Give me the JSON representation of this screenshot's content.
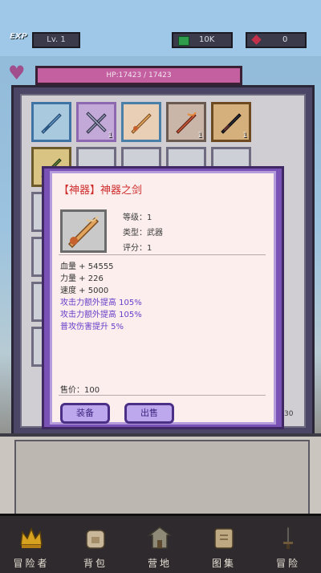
{
  "top": {
    "exp_label": "EXP",
    "level": "Lv. 1",
    "money": "10K",
    "gems": "0"
  },
  "hp": {
    "text": "HP:17423 / 17423"
  },
  "inventory": {
    "slots": [
      {
        "count": "",
        "accent": "#3f73a3"
      },
      {
        "count": "1",
        "accent": "#8d67b0"
      },
      {
        "count": "",
        "accent": "#b08060"
      },
      {
        "count": "1",
        "accent": "#a14f3a"
      },
      {
        "count": "1",
        "accent": "#2c2c3a"
      },
      {
        "count": "",
        "accent": "#5b7a3a"
      }
    ],
    "extra_count": "30"
  },
  "modal": {
    "title": "【神器】神器之剑",
    "level": "等级：1",
    "type": "类型：武器",
    "score": "评分：1",
    "attributes": [
      "血量 + 54555",
      "力量 + 226",
      "速度 + 5000"
    ],
    "specials": [
      "攻击力额外提高 105%",
      "攻击力额外提高 105%",
      "普攻伤害提升 5%"
    ],
    "price": "售价：100",
    "equip_label": "装备",
    "sell_label": "出售"
  },
  "nav": [
    {
      "label": "冒险者",
      "icon": "crown-icon"
    },
    {
      "label": "背包",
      "icon": "backpack-icon"
    },
    {
      "label": "营地",
      "icon": "camp-icon"
    },
    {
      "label": "图集",
      "icon": "book-icon"
    },
    {
      "label": "冒险",
      "icon": "sword-icon"
    }
  ],
  "colors": {
    "panel": "#4b4666",
    "modal_border": "#7a52b5",
    "title_red": "#cf2d2d",
    "special_purple": "#6a3ec9"
  }
}
